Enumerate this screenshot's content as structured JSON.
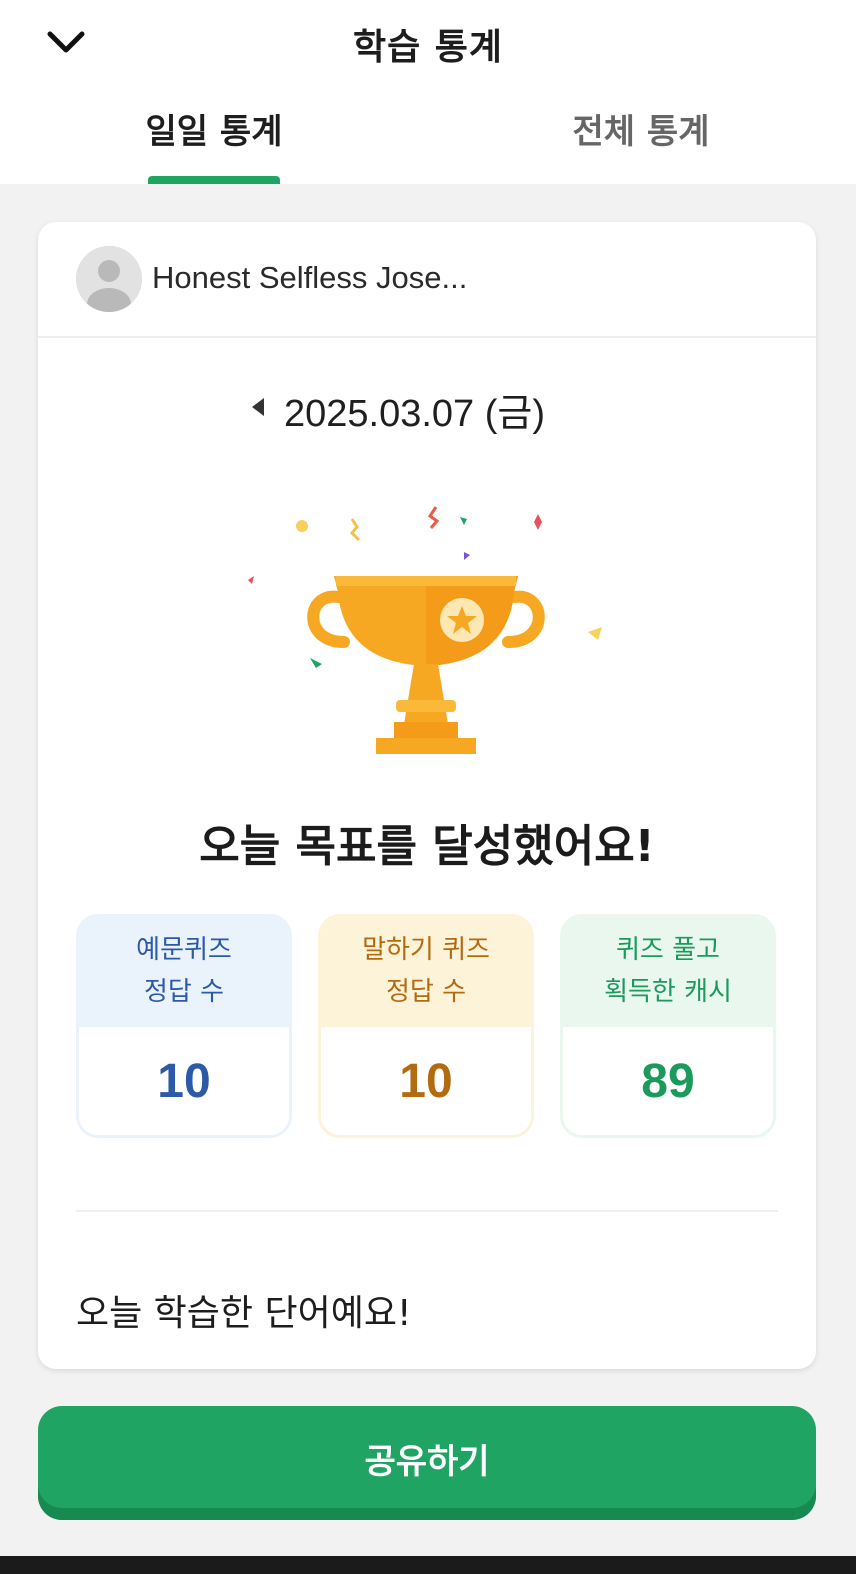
{
  "header": {
    "title": "학습 통계",
    "tabs": [
      {
        "label": "일일 통계",
        "active": true
      },
      {
        "label": "전체 통계",
        "active": false
      }
    ]
  },
  "profile": {
    "name": "Honest Selfless Jose..."
  },
  "date": {
    "value": "2025.03.07 (금)"
  },
  "goal": {
    "message": "오늘 목표를 달성했어요!"
  },
  "stats": [
    {
      "label": "예문퀴즈\n정답 수",
      "value": "10",
      "color": "#2c5aa8"
    },
    {
      "label": "말하기 퀴즈\n정답 수",
      "value": "10",
      "color": "#b36b10"
    },
    {
      "label": "퀴즈 풀고\n획득한 캐시",
      "value": "89",
      "color": "#1a9a5b"
    }
  ],
  "words": {
    "title": "오늘 학습한 단어예요!"
  },
  "share": {
    "label": "공유하기"
  },
  "colors": {
    "accent": "#1fa463",
    "trophy": "#f7a823"
  },
  "icons": [
    "chevron-down-icon",
    "avatar-icon",
    "caret-left-icon",
    "trophy-icon"
  ]
}
